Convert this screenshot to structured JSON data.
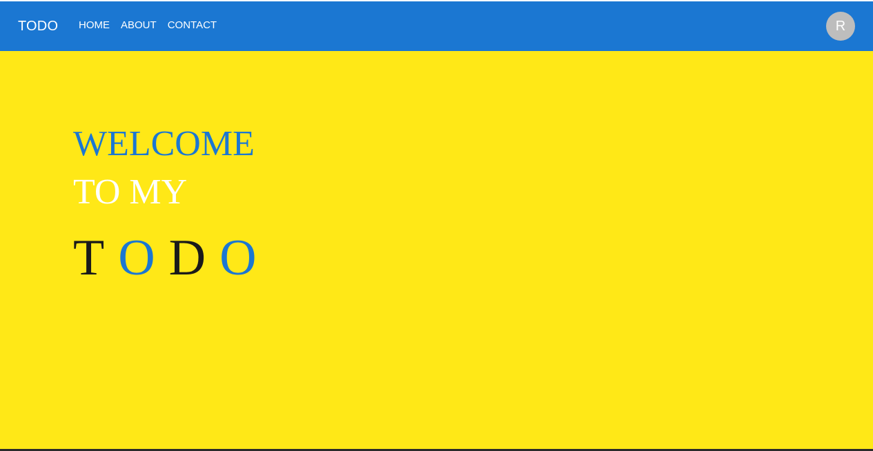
{
  "navbar": {
    "brand": "TODO",
    "links": [
      {
        "label": "HOME"
      },
      {
        "label": "ABOUT"
      },
      {
        "label": "CONTACT"
      }
    ],
    "avatar_initial": "R"
  },
  "hero": {
    "line1": "WELCOME",
    "line2": "TO MY",
    "todo_letters": [
      {
        "char": "T",
        "color": "#1a1a1a"
      },
      {
        "char": "O",
        "color": "#1b77d2"
      },
      {
        "char": "D",
        "color": "#1a1a1a"
      },
      {
        "char": "O",
        "color": "#1b77d2"
      }
    ]
  },
  "colors": {
    "navbar_bg": "#1b77d2",
    "page_bg": "#ffe817",
    "accent_blue": "#1b77d2",
    "dark_text": "#1a1a1a",
    "avatar_bg": "#bdbdbd"
  }
}
